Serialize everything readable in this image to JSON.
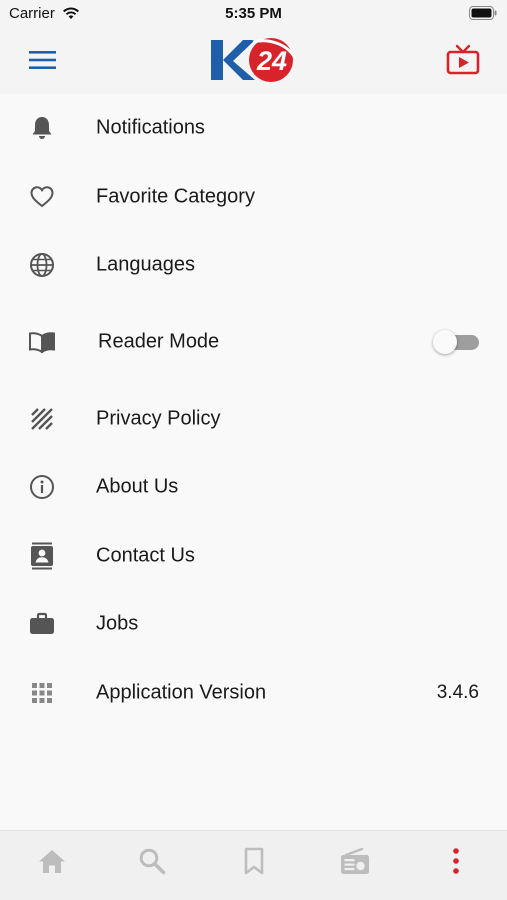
{
  "status_bar": {
    "carrier": "Carrier",
    "time": "5:35 PM",
    "icons": [
      "wifi-icon",
      "battery-icon"
    ]
  },
  "nav_bar": {
    "left_icon": "hamburger-menu-icon",
    "logo_text": "K24",
    "right_icon": "live-tv-icon",
    "accent_blue": "#1f5ea8",
    "accent_red": "#d7232a"
  },
  "settings": {
    "items": [
      {
        "icon": "bell-icon",
        "label": "Notifications"
      },
      {
        "icon": "heart-icon",
        "label": "Favorite Category"
      },
      {
        "icon": "globe-icon",
        "label": "Languages"
      },
      {
        "icon": "book-icon",
        "label": "Reader Mode",
        "toggle": false
      },
      {
        "icon": "hatch-icon",
        "label": "Privacy Policy"
      },
      {
        "icon": "info-icon",
        "label": "About Us"
      },
      {
        "icon": "contact-card-icon",
        "label": "Contact Us"
      },
      {
        "icon": "briefcase-icon",
        "label": "Jobs"
      },
      {
        "icon": "grid-icon",
        "label": "Application Version",
        "value": "3.4.6"
      }
    ]
  },
  "tab_bar": {
    "tabs": [
      {
        "icon": "home-icon",
        "active": false
      },
      {
        "icon": "search-icon",
        "active": false
      },
      {
        "icon": "bookmark-icon",
        "active": false
      },
      {
        "icon": "radio-icon",
        "active": false
      },
      {
        "icon": "more-vertical-icon",
        "active": true
      }
    ],
    "inactive_color": "#bdbdbd",
    "active_color": "#d7232a"
  }
}
